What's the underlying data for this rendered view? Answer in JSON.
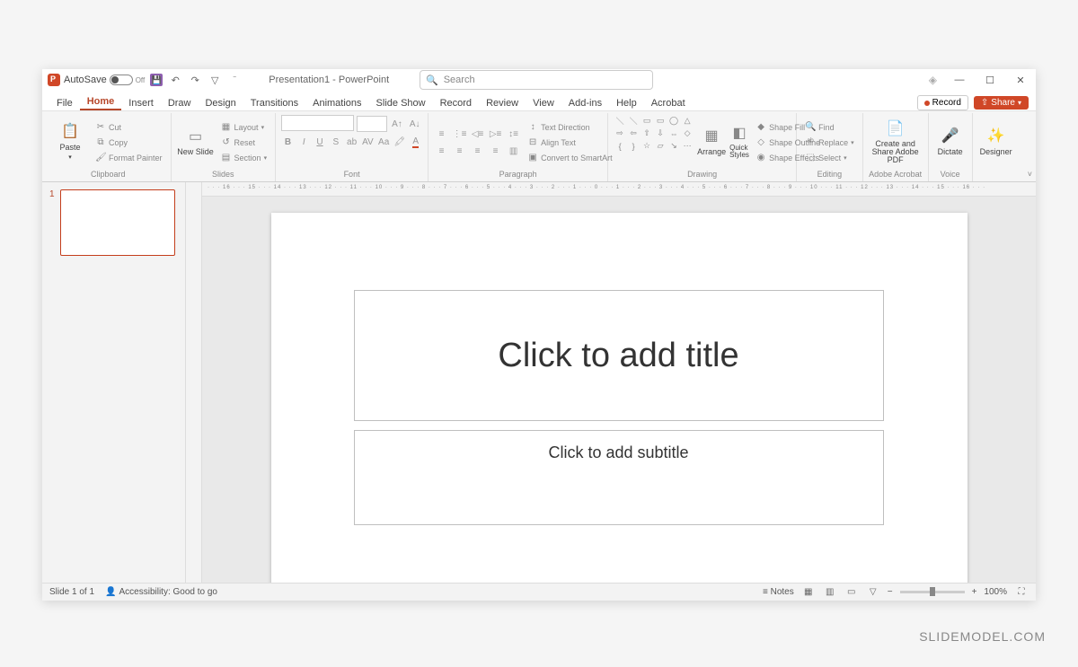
{
  "titlebar": {
    "autosave_label": "AutoSave",
    "autosave_state": "Off",
    "doc_title": "Presentation1 - PowerPoint",
    "search_placeholder": "Search"
  },
  "tabs": {
    "items": [
      "File",
      "Home",
      "Insert",
      "Draw",
      "Design",
      "Transitions",
      "Animations",
      "Slide Show",
      "Record",
      "Review",
      "View",
      "Add-ins",
      "Help",
      "Acrobat"
    ],
    "active": "Home",
    "record_label": "Record",
    "share_label": "Share"
  },
  "ribbon": {
    "clipboard": {
      "paste": "Paste",
      "cut": "Cut",
      "copy": "Copy",
      "format_painter": "Format Painter",
      "label": "Clipboard"
    },
    "slides": {
      "new_slide": "New Slide",
      "layout": "Layout",
      "reset": "Reset",
      "section": "Section",
      "label": "Slides"
    },
    "font": {
      "label": "Font"
    },
    "paragraph": {
      "text_direction": "Text Direction",
      "align_text": "Align Text",
      "convert_smartart": "Convert to SmartArt",
      "label": "Paragraph"
    },
    "drawing": {
      "arrange": "Arrange",
      "quick_styles": "Quick Styles",
      "shape_fill": "Shape Fill",
      "shape_outline": "Shape Outline",
      "shape_effects": "Shape Effects",
      "label": "Drawing"
    },
    "editing": {
      "find": "Find",
      "replace": "Replace",
      "select": "Select",
      "label": "Editing"
    },
    "acrobat": {
      "create_share": "Create and Share Adobe PDF",
      "label": "Adobe Acrobat"
    },
    "voice": {
      "dictate": "Dictate",
      "label": "Voice"
    },
    "designer": {
      "label": "Designer"
    }
  },
  "ruler": {
    "marks": "· · · 16 · · · 15 · · · 14 · · · 13 · · · 12 · · · 11 · · · 10 · · · 9 · · · 8 · · · 7 · · · 6 · · · 5 · · · 4 · · · 3 · · · 2 · · · 1 · · · 0 · · · 1 · · · 2 · · · 3 · · · 4 · · · 5 · · · 6 · · · 7 · · · 8 · · · 9 · · · 10 · · · 11 · · · 12 · · · 13 · · · 14 · · · 15 · · · 16 · · ·"
  },
  "slide": {
    "number": "1",
    "title_placeholder": "Click to add title",
    "subtitle_placeholder": "Click to add subtitle"
  },
  "status": {
    "slide_of": "Slide 1 of 1",
    "accessibility": "Accessibility: Good to go",
    "notes": "Notes",
    "zoom": "100%"
  },
  "watermark": "SLIDEMODEL.COM"
}
